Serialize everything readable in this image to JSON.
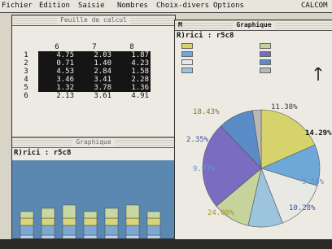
{
  "menu": {
    "items": [
      "Fichier",
      "Edition",
      "Saisie",
      "Nombres",
      "Choix-divers",
      "Options",
      "CALCOM"
    ]
  },
  "sheet_window": {
    "title": "Feuille de calcul",
    "columns": [
      "6",
      "7",
      "8"
    ],
    "rows": [
      {
        "num": "1",
        "cells": [
          "4.75",
          "2.03",
          "1.87"
        ]
      },
      {
        "num": "2",
        "cells": [
          "0.71",
          "1.40",
          "4.23"
        ]
      },
      {
        "num": "3",
        "cells": [
          "4.53",
          "2.84",
          "1.58"
        ]
      },
      {
        "num": "4",
        "cells": [
          "3.46",
          "3.41",
          "2.28"
        ]
      },
      {
        "num": "5",
        "cells": [
          "1.32",
          "3.78",
          "1.36"
        ]
      },
      {
        "num": "6",
        "cells": [
          "2.13",
          "3.61",
          "4.91"
        ]
      }
    ]
  },
  "graph_window_left": {
    "title": "Graphique",
    "reference": "R)rici : r5c8"
  },
  "graph_window_right": {
    "title": "Graphique",
    "marker": "M",
    "reference": "R)rici : r5c8",
    "pie_labels": [
      "18.43%",
      "11.38%",
      "14.29%",
      "2.35%",
      "9.77%",
      "24.08%",
      "10.28%",
      "9.58%"
    ]
  },
  "colors": {
    "pie": [
      "#d6d26c",
      "#6ea8d8",
      "#e8e8e4",
      "#9cc4dc",
      "#c4d49c",
      "#7a6cc0",
      "#5c8cc8",
      "#b8b8b4"
    ],
    "screen": "#d9d4c8"
  },
  "chart_data": {
    "type": "pie",
    "title": "Graphique",
    "categories": [],
    "values": [
      18.43,
      11.38,
      14.29,
      9.58,
      10.28,
      24.08,
      9.77,
      2.35
    ]
  }
}
